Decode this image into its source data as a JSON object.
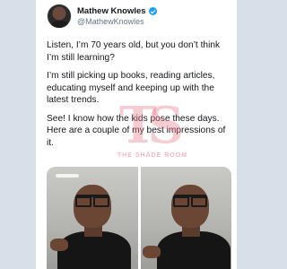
{
  "tweet": {
    "author": {
      "display_name": "Mathew Knowles",
      "handle": "@MathewKnowles",
      "verified": true
    },
    "paragraphs": [
      "Listen, I’m 70 years old, but you don’t think I’m still learning?",
      "I’m still picking up books, reading articles, educating myself and keeping up with the latest trends.",
      "See! I know how the kids pose these days. Here are a couple of my best impressions of it."
    ],
    "media_count": 2
  },
  "watermark": {
    "text": "THE SHADE ROOM"
  },
  "colors": {
    "background": "#d8dfe9",
    "verified_badge": "#1da1f2",
    "text": "#14171a",
    "handle": "#657786"
  }
}
